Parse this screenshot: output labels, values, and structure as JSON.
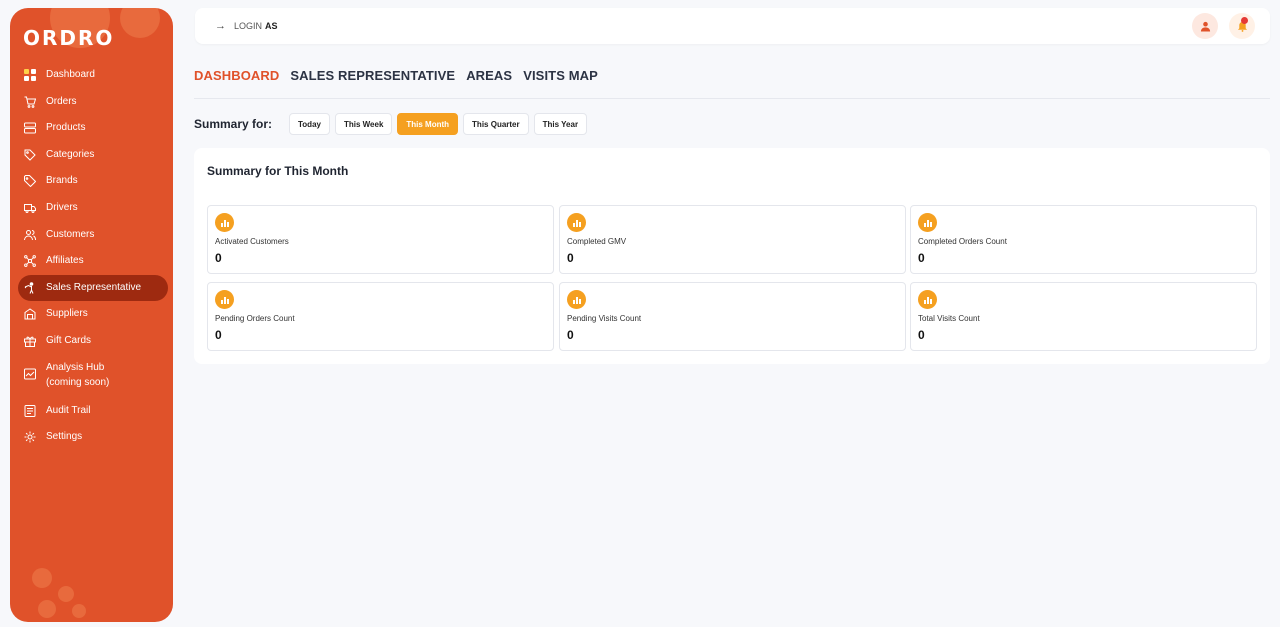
{
  "brand": {
    "logo": "ORDRO",
    "accent": "#e0522a",
    "active_period_color": "#f5a020"
  },
  "sidebar": {
    "items": [
      {
        "label": "Dashboard",
        "icon": "dashboard-grid-icon"
      },
      {
        "label": "Orders",
        "icon": "cart-icon"
      },
      {
        "label": "Products",
        "icon": "products-icon"
      },
      {
        "label": "Categories",
        "icon": "categories-icon"
      },
      {
        "label": "Brands",
        "icon": "tag-icon"
      },
      {
        "label": "Drivers",
        "icon": "truck-icon"
      },
      {
        "label": "Customers",
        "icon": "users-icon"
      },
      {
        "label": "Affiliates",
        "icon": "affiliates-icon"
      },
      {
        "label": "Sales Representative",
        "icon": "sales-rep-icon"
      },
      {
        "label": "Suppliers",
        "icon": "suppliers-icon"
      },
      {
        "label": "Gift Cards",
        "icon": "gift-icon"
      },
      {
        "label": "Analysis Hub (coming soon)",
        "icon": "analysis-icon"
      },
      {
        "label": "Audit Trail",
        "icon": "audit-icon"
      },
      {
        "label": "Settings",
        "icon": "gear-icon"
      }
    ],
    "active": "Sales Representative"
  },
  "topbar": {
    "login_prefix": "LOGIN",
    "login_suffix": "AS"
  },
  "tabs": [
    {
      "label": "DASHBOARD",
      "active": true
    },
    {
      "label": "SALES REPRESENTATIVE",
      "active": false
    },
    {
      "label": "AREAS",
      "active": false
    },
    {
      "label": "VISITS MAP",
      "active": false
    }
  ],
  "summary": {
    "label": "Summary for:",
    "periods": [
      "Today",
      "This Week",
      "This Month",
      "This Quarter",
      "This Year"
    ],
    "selected": "This Month",
    "title": "Summary for This Month",
    "stats": [
      {
        "label": "Activated Customers",
        "value": "0"
      },
      {
        "label": "Completed GMV",
        "value": "0"
      },
      {
        "label": "Completed Orders Count",
        "value": "0"
      },
      {
        "label": "Pending Orders Count",
        "value": "0"
      },
      {
        "label": "Pending Visits Count",
        "value": "0"
      },
      {
        "label": "Total Visits Count",
        "value": "0"
      }
    ]
  }
}
